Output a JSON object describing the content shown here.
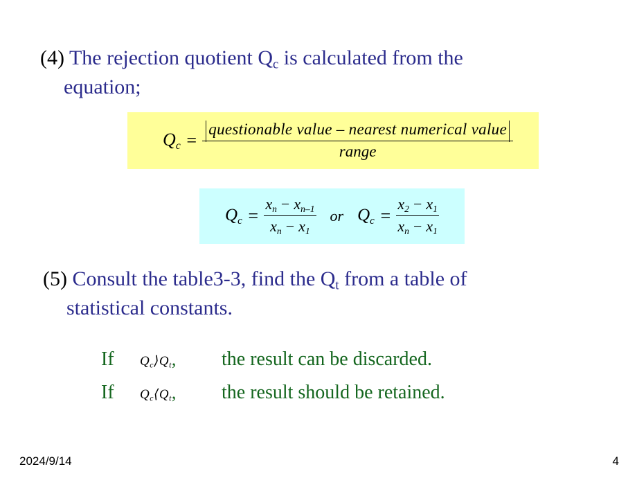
{
  "slide": {
    "bullet_4": {
      "number": "(4)",
      "line1": "The rejection quotient Q",
      "line1_sub": "c",
      "line1_rest": " is calculated from the",
      "line2": "equation;"
    },
    "bullet_5": {
      "number": "(5)",
      "line1": "Consult the table3-3, find the Q",
      "line1_sub": "t",
      "line1_rest": " from a table of",
      "line2": "statistical constants."
    },
    "equation_main": {
      "background_color": "#FFFF99",
      "lhs": "Q",
      "lhs_sub": "c",
      "equals": "=",
      "numerator": "questionable   value – nearest   numerical   value",
      "denominator": "range",
      "abs_bar": "|"
    },
    "equation_alt": {
      "background_color": "#CCFFFF",
      "first": {
        "lhs": "Q",
        "lhs_sub": "c",
        "equals": "=",
        "num_left": "x",
        "num_left_sub": "n",
        "num_minus": "−",
        "num_right": "x",
        "num_right_sub": "n–1",
        "den_left": "x",
        "den_left_sub": "n",
        "den_minus": "−",
        "den_right": "x",
        "den_right_sub": "1"
      },
      "connector": "or",
      "second": {
        "lhs": "Q",
        "lhs_sub": "c",
        "equals": "=",
        "num_left": "x",
        "num_left_sub": "2",
        "num_minus": "−",
        "num_right": "x",
        "num_right_sub": "1",
        "den_left": "x",
        "den_left_sub": "n",
        "den_minus": "−",
        "den_right": "x",
        "den_right_sub": "1"
      }
    },
    "conditions": [
      {
        "if_word": "If",
        "expr_lhs": "Q",
        "expr_lhs_sub": "c",
        "operator": "⟩",
        "expr_rhs": "Q",
        "expr_rhs_sub": "t",
        "comma": ",",
        "outcome": "the result can be discarded."
      },
      {
        "if_word": "If",
        "expr_lhs": "Q",
        "expr_lhs_sub": "c",
        "operator": "⟨",
        "expr_rhs": "Q",
        "expr_rhs_sub": "t",
        "comma": ",",
        "outcome": "the result should be retained."
      }
    ],
    "footer": {
      "date": "2024/9/14",
      "page_number": "4"
    },
    "colors": {
      "body_text": "#2B2B8C",
      "condition_text": "#14661E",
      "number_text": "#000000",
      "highlight_yellow": "#FFFF99",
      "highlight_cyan": "#CCFFFF"
    }
  }
}
